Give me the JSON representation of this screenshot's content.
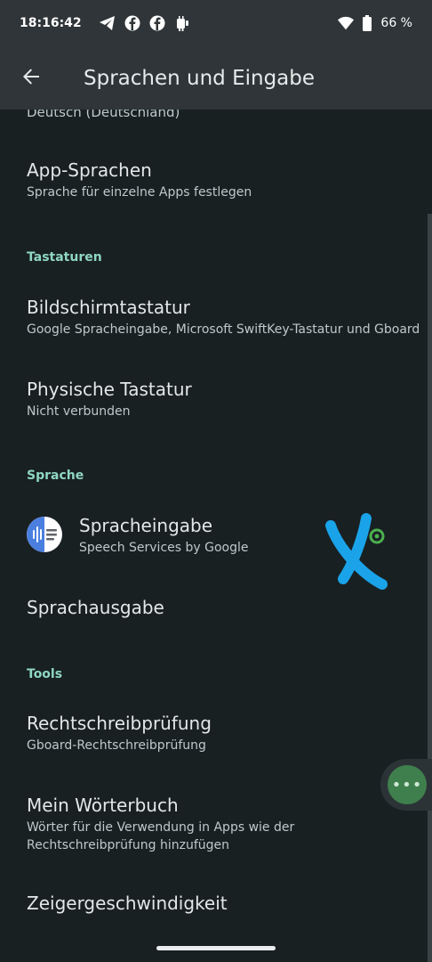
{
  "status_bar": {
    "time": "18:16:42",
    "battery_text": "66 %",
    "icons": [
      "telegram-icon",
      "facebook-icon",
      "facebook-icon",
      "android-icon",
      "wifi-icon",
      "battery-icon"
    ]
  },
  "app_bar": {
    "title": "Sprachen und Eingabe",
    "back_icon": "arrow-back-icon"
  },
  "partial_item": {
    "subtitle": "Deutsch (Deutschland)"
  },
  "items": {
    "app_sprachen": {
      "title": "App-Sprachen",
      "subtitle": "Sprache für einzelne Apps festlegen"
    },
    "bildschirmtastatur": {
      "title": "Bildschirmtastatur",
      "subtitle": "Google Spracheingabe, Microsoft SwiftKey-Tastatur und Gboard"
    },
    "physische_tastatur": {
      "title": "Physische Tastatur",
      "subtitle": "Nicht verbunden"
    },
    "spracheingabe": {
      "title": "Spracheingabe",
      "subtitle": "Speech Services by Google"
    },
    "sprachausgabe": {
      "title": "Sprachausgabe"
    },
    "rechtschreibpruefung": {
      "title": "Rechtschreibprüfung",
      "subtitle": "Gboard-Rechtschreibprüfung"
    },
    "mein_woerterbuch": {
      "title": "Mein Wörterbuch",
      "subtitle_line1": "Wörter für die Verwendung in Apps wie der",
      "subtitle_line2": "Rechtschreibprüfung hinzufügen"
    },
    "zeigergeschwindigkeit": {
      "title": "Zeigergeschwindigkeit"
    }
  },
  "sections": {
    "tastaturen": "Tastaturen",
    "sprache": "Sprache",
    "tools": "Tools"
  },
  "floating_button": {
    "label": "•••"
  },
  "colors": {
    "background": "#182022",
    "app_bar": "#2f3538",
    "section_header": "#8fd7c0",
    "accent_blue": "#1aa3e8"
  }
}
